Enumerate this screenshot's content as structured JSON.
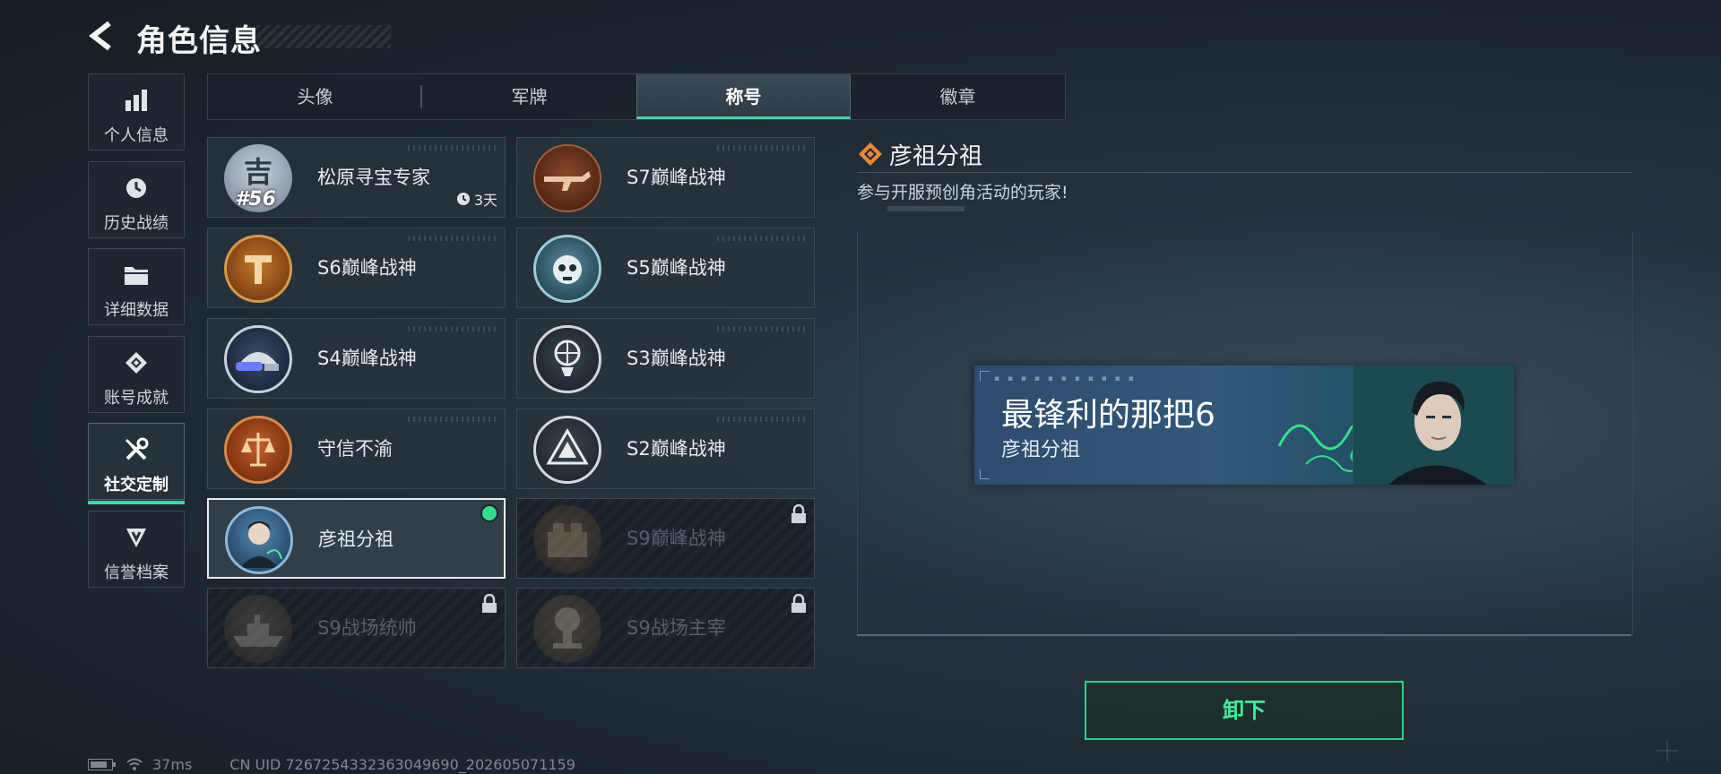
{
  "header": {
    "title": "角色信息"
  },
  "sidebar": {
    "items": [
      {
        "label": "个人信息",
        "icon": "bar-chart-icon"
      },
      {
        "label": "历史战绩",
        "icon": "history-clock-icon"
      },
      {
        "label": "详细数据",
        "icon": "folder-icon"
      },
      {
        "label": "账号成就",
        "icon": "achievement-icon"
      },
      {
        "label": "社交定制",
        "icon": "tools-icon",
        "active": true
      },
      {
        "label": "信誉档案",
        "icon": "shield-emblem-icon"
      }
    ]
  },
  "tabs": [
    {
      "label": "头像"
    },
    {
      "label": "军牌"
    },
    {
      "label": "称号",
      "active": true
    },
    {
      "label": "徽章"
    }
  ],
  "titles": [
    {
      "name": "松原寻宝专家",
      "badge_text": "吉",
      "rank": "#56",
      "timer": "3天"
    },
    {
      "name": "S7巅峰战神"
    },
    {
      "name": "S6巅峰战神"
    },
    {
      "name": "S5巅峰战神"
    },
    {
      "name": "S4巅峰战神"
    },
    {
      "name": "S3巅峰战神"
    },
    {
      "name": "守信不渝"
    },
    {
      "name": "S2巅峰战神"
    },
    {
      "name": "彦祖分祖",
      "selected": true,
      "equipped": true
    },
    {
      "name": "S9巅峰战神",
      "locked": true
    },
    {
      "name": "S9战场统帅",
      "locked": true
    },
    {
      "name": "S9战场主宰",
      "locked": true
    }
  ],
  "detail": {
    "name": "彦祖分祖",
    "description": "参与开服预创角活动的玩家!",
    "banner": {
      "title": "最锋利的那把6",
      "subtitle": "彦祖分祖"
    },
    "unequip_label": "卸下"
  },
  "status": {
    "ping": "37ms",
    "uid": "CN UID 7267254332363049690_202605071159"
  },
  "colors": {
    "accent": "#3fd8a0",
    "equipped_dot": "#2ee08a",
    "detail_icon": "#e8893a"
  }
}
